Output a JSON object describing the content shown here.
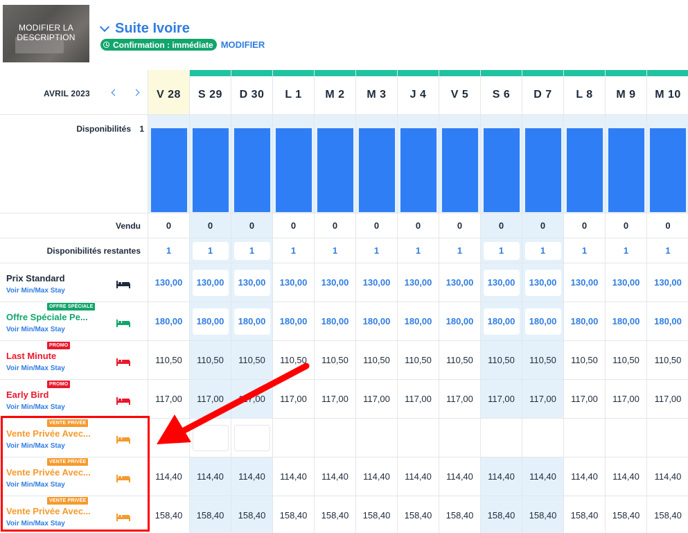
{
  "header": {
    "thumbnail_label": "MODIFIER LA DESCRIPTION",
    "room_name": "Suite Ivoire",
    "confirmation": "Confirmation : immédiate",
    "modify_link": "MODIFIER"
  },
  "calendar": {
    "month": "AVRIL 2023",
    "days": [
      "V 28",
      "S 29",
      "D 30",
      "L 1",
      "M 2",
      "M 3",
      "J 4",
      "V 5",
      "S 6",
      "D 7",
      "L 8",
      "M 9",
      "M 10"
    ],
    "highlight_today_index": 0,
    "weekend_indices": [
      1,
      2,
      8,
      9
    ]
  },
  "availability": {
    "label": "Disponibilités",
    "count": "1"
  },
  "sold": {
    "label": "Vendu",
    "values": [
      "0",
      "0",
      "0",
      "0",
      "0",
      "0",
      "0",
      "0",
      "0",
      "0",
      "0",
      "0",
      "0"
    ]
  },
  "remaining": {
    "label": "Disponibilités restantes",
    "values": [
      "1",
      "1",
      "1",
      "1",
      "1",
      "1",
      "1",
      "1",
      "1",
      "1",
      "1",
      "1",
      "1"
    ]
  },
  "rates": [
    {
      "name": "Prix Standard",
      "name_color": "#1d2a3a",
      "badge": "",
      "badge_color": "",
      "icon_color": "#1d2a3a",
      "price_style": "blue",
      "link": "Voir Min/Max Stay",
      "prices": [
        "130,00",
        "130,00",
        "130,00",
        "130,00",
        "130,00",
        "130,00",
        "130,00",
        "130,00",
        "130,00",
        "130,00",
        "130,00",
        "130,00",
        "130,00"
      ]
    },
    {
      "name": "Offre Spéciale Pe...",
      "name_color": "#12a56c",
      "badge": "OFFRE SPÉCIALE",
      "badge_color": "#12a56c",
      "icon_color": "#12a56c",
      "price_style": "blue",
      "link": "Voir Min/Max Stay",
      "prices": [
        "180,00",
        "180,00",
        "180,00",
        "180,00",
        "180,00",
        "180,00",
        "180,00",
        "180,00",
        "180,00",
        "180,00",
        "180,00",
        "180,00",
        "180,00"
      ]
    },
    {
      "name": "Last Minute",
      "name_color": "#e8192c",
      "badge": "PROMO",
      "badge_color": "#e8192c",
      "icon_color": "#e8192c",
      "price_style": "dark",
      "link": "Voir Min/Max Stay",
      "prices": [
        "110,50",
        "110,50",
        "110,50",
        "110,50",
        "110,50",
        "110,50",
        "110,50",
        "110,50",
        "110,50",
        "110,50",
        "110,50",
        "110,50",
        "110,50"
      ]
    },
    {
      "name": "Early Bird",
      "name_color": "#e8192c",
      "badge": "PROMO",
      "badge_color": "#e8192c",
      "icon_color": "#e8192c",
      "price_style": "dark",
      "link": "Voir Min/Max Stay",
      "prices": [
        "117,00",
        "117,00",
        "117,00",
        "117,00",
        "117,00",
        "117,00",
        "117,00",
        "117,00",
        "117,00",
        "117,00",
        "117,00",
        "117,00",
        "117,00"
      ]
    },
    {
      "name": "Vente Privée Avec...",
      "name_color": "#f59a2d",
      "badge": "VENTE PRIVÉE",
      "badge_color": "#f59a2d",
      "icon_color": "#f59a2d",
      "price_style": "dark",
      "link": "Voir Min/Max Stay",
      "prices": [
        "",
        "",
        "",
        "",
        "",
        "",
        "",
        "",
        "",
        "",
        "",
        "",
        ""
      ]
    },
    {
      "name": "Vente Privée Avec...",
      "name_color": "#f59a2d",
      "badge": "VENTE PRIVÉE",
      "badge_color": "#f59a2d",
      "icon_color": "#f59a2d",
      "price_style": "dark",
      "link": "Voir Min/Max Stay",
      "prices": [
        "114,40",
        "114,40",
        "114,40",
        "114,40",
        "114,40",
        "114,40",
        "114,40",
        "114,40",
        "114,40",
        "114,40",
        "114,40",
        "114,40",
        "114,40"
      ]
    },
    {
      "name": "Vente Privée Avec...",
      "name_color": "#f59a2d",
      "badge": "VENTE PRIVÉE",
      "badge_color": "#f59a2d",
      "icon_color": "#f59a2d",
      "price_style": "dark",
      "link": "Voir Min/Max Stay",
      "prices": [
        "158,40",
        "158,40",
        "158,40",
        "158,40",
        "158,40",
        "158,40",
        "158,40",
        "158,40",
        "158,40",
        "158,40",
        "158,40",
        "158,40",
        "158,40"
      ]
    }
  ],
  "colors": {
    "accent": "#2f7de1",
    "availability_bar": "#2f7ef5",
    "top_bar": "#1ec3a0",
    "annotation": "#ff0000"
  }
}
